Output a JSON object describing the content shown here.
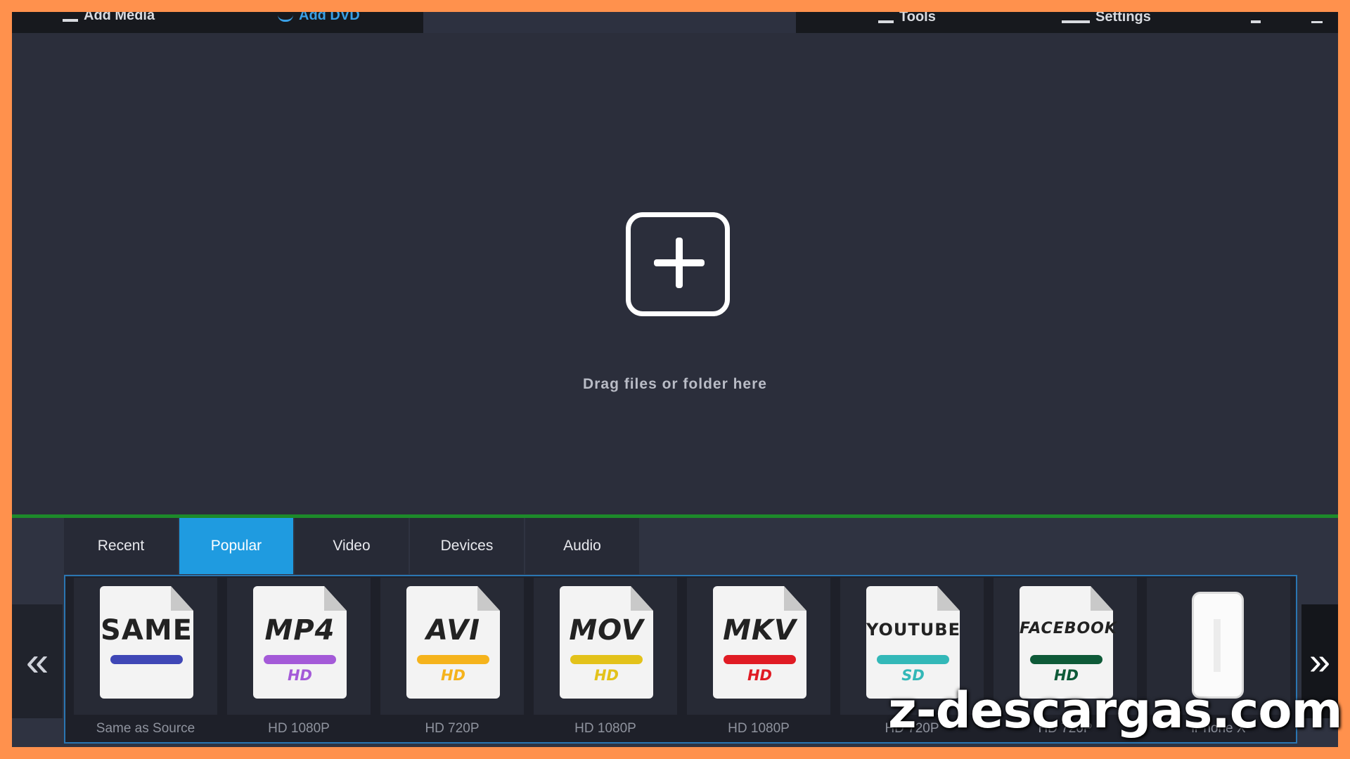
{
  "topbar": {
    "items": [
      {
        "label": "Add Media",
        "icon": "plus-icon"
      },
      {
        "label": "Add DVD",
        "icon": "disc-icon"
      },
      {
        "label": "Tools",
        "icon": "magic-wand-icon"
      },
      {
        "label": "Settings",
        "icon": "settings-icon"
      }
    ]
  },
  "dropzone": {
    "add_icon": "plus-square-icon",
    "text": "Drag files or folder here"
  },
  "tabs": [
    {
      "label": "Recent",
      "active": false
    },
    {
      "label": "Popular",
      "active": true
    },
    {
      "label": "Video",
      "active": false
    },
    {
      "label": "Devices",
      "active": false
    },
    {
      "label": "Audio",
      "active": false
    }
  ],
  "nav": {
    "prev": "«",
    "next": "»"
  },
  "formats": [
    {
      "name": "SAME",
      "quality": "",
      "pill_color": "#3f47b6",
      "res_color": "#3f47b6",
      "subtitle": "Same as Source"
    },
    {
      "name": "MP4",
      "quality": "HD",
      "pill_color": "#a45ad8",
      "res_color": "#a45ad8",
      "subtitle": "HD 1080P"
    },
    {
      "name": "AVI",
      "quality": "HD",
      "pill_color": "#f5b31c",
      "res_color": "#f5b31c",
      "subtitle": "HD 720P"
    },
    {
      "name": "MOV",
      "quality": "HD",
      "pill_color": "#e3c21a",
      "res_color": "#e3c21a",
      "subtitle": "HD 1080P"
    },
    {
      "name": "MKV",
      "quality": "HD",
      "pill_color": "#e01b24",
      "res_color": "#e01b24",
      "subtitle": "HD 1080P"
    },
    {
      "name": "YOUTUBE",
      "quality": "SD",
      "pill_color": "#33b8b8",
      "res_color": "#33b8b8",
      "subtitle": "HD 720P"
    },
    {
      "name": "FACEBOOK",
      "quality": "HD",
      "pill_color": "#0e5a38",
      "res_color": "#0e5a38",
      "subtitle": "HD 720P"
    },
    {
      "name": "",
      "quality": "",
      "pill_color": "",
      "res_color": "",
      "subtitle": "iPhone X"
    }
  ],
  "watermark": "z-descargas.com"
}
